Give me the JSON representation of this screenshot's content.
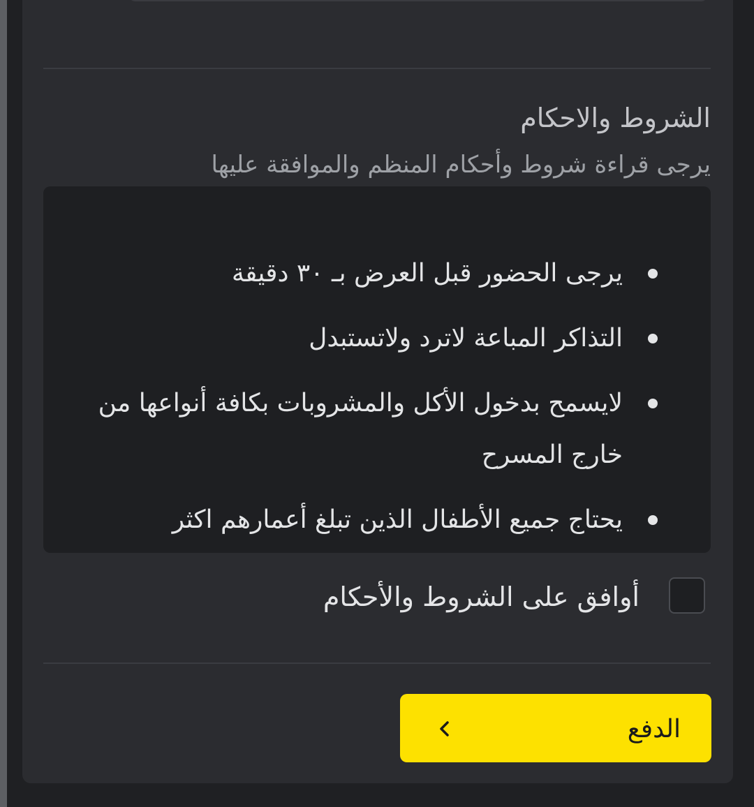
{
  "terms": {
    "title": "الشروط والاحكام",
    "subtitle": "يرجى قراءة شروط وأحكام المنظم والموافقة عليها",
    "items": [
      "يرجى الحضور قبل العرض بـ ٣٠ دقيقة",
      "التذاكر المباعة لاترد ولاتستبدل",
      "لايسمح بدخول الأكل والمشروبات بكافة أنواعها من خارج المسرح",
      "يحتاج جميع الأطفال الذين تبلغ أعمارهم اكثر"
    ]
  },
  "agreement": {
    "label": "أوافق على الشروط والأحكام",
    "checked": false
  },
  "payment": {
    "button_label": "الدفع",
    "button_color": "#fde100",
    "icon": "chevron-left-icon"
  },
  "colors": {
    "background": "#1f2023",
    "card": "#2b2c30",
    "terms_box": "#1e1f22",
    "text_primary": "#e4e5e7",
    "text_secondary": "#9ea1a6"
  }
}
